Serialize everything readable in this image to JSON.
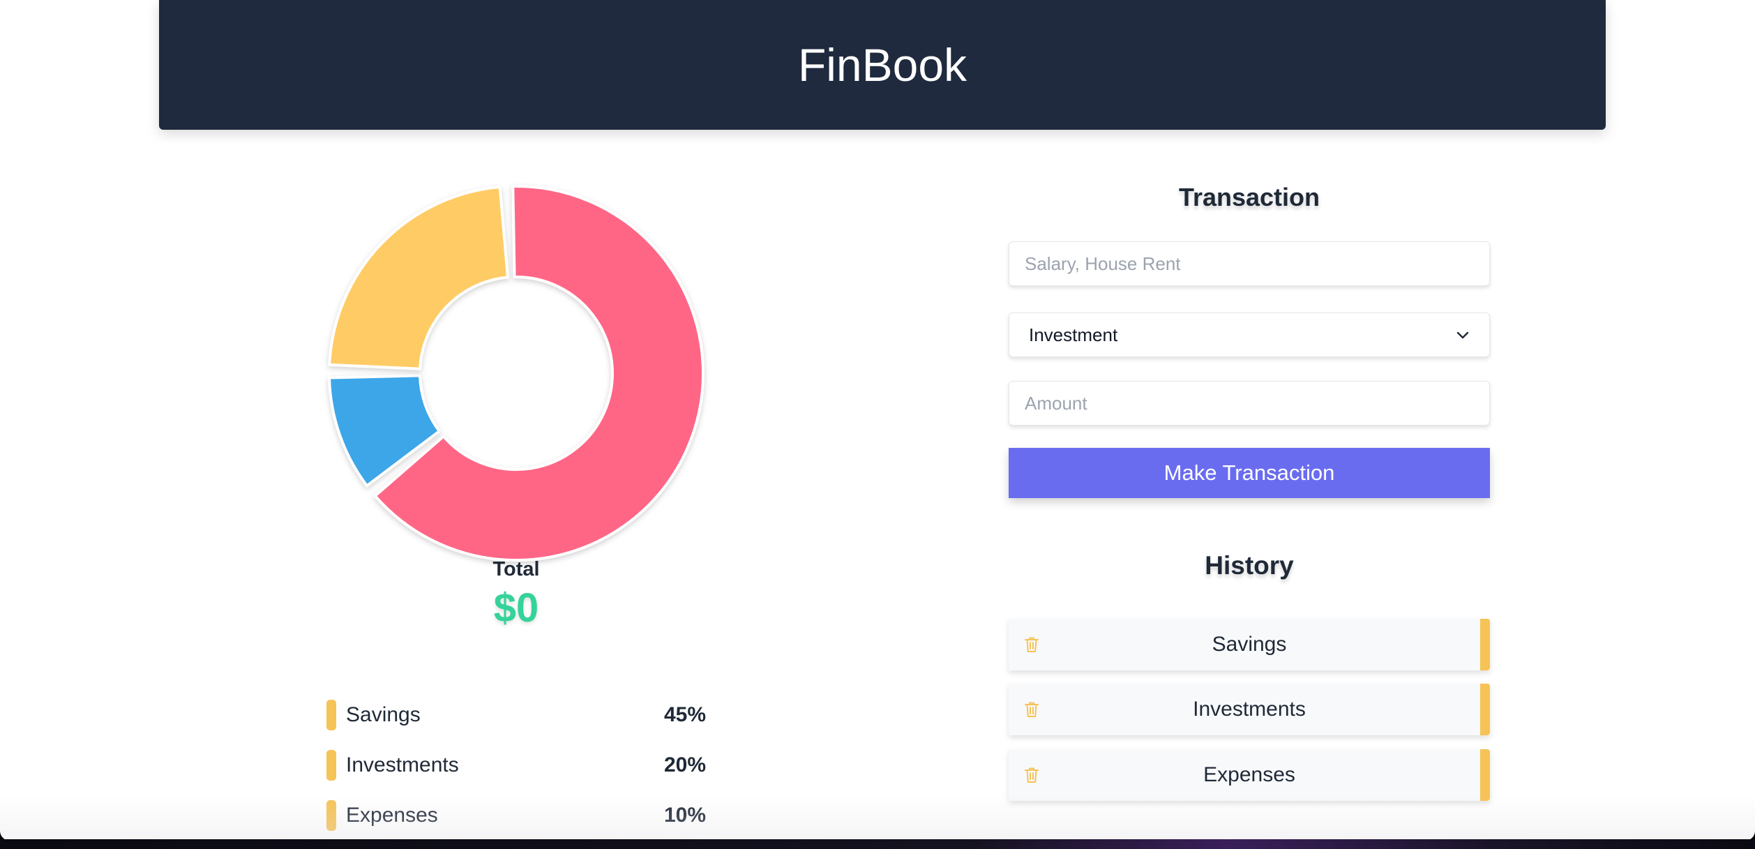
{
  "app": {
    "title": "FinBook"
  },
  "colors": {
    "header_bg": "#1f2a3e",
    "accent_button": "#6a6cf0",
    "total_value": "#34d399",
    "savings": "#ffcb65",
    "investments": "#ff6686",
    "expenses": "#3ea6e8"
  },
  "chart_data": {
    "type": "pie",
    "donut": true,
    "title": "",
    "series": [
      {
        "name": "Investments",
        "value": 65,
        "color": "#ff6686"
      },
      {
        "name": "Expenses",
        "value": 11,
        "color": "#3ea6e8"
      },
      {
        "name": "Savings",
        "value": 24,
        "color": "#ffcb65"
      }
    ]
  },
  "total": {
    "label": "Total",
    "value": "$0"
  },
  "labels": {
    "items": [
      {
        "name": "Savings",
        "percent": "45%",
        "color": "#f6c356"
      },
      {
        "name": "Investments",
        "percent": "20%",
        "color": "#f6c356"
      },
      {
        "name": "Expenses",
        "percent": "10%",
        "color": "#f6c356"
      }
    ]
  },
  "transaction": {
    "title": "Transaction",
    "name_placeholder": "Salary, House Rent",
    "type_selected": "Investment",
    "amount_placeholder": "Amount",
    "submit_label": "Make Transaction"
  },
  "history": {
    "title": "History",
    "items": [
      {
        "name": "Savings",
        "color": "#f6c356",
        "icon": "trash-icon"
      },
      {
        "name": "Investments",
        "color": "#f6c356",
        "icon": "trash-icon"
      },
      {
        "name": "Expenses",
        "color": "#f6c356",
        "icon": "trash-icon"
      }
    ]
  }
}
